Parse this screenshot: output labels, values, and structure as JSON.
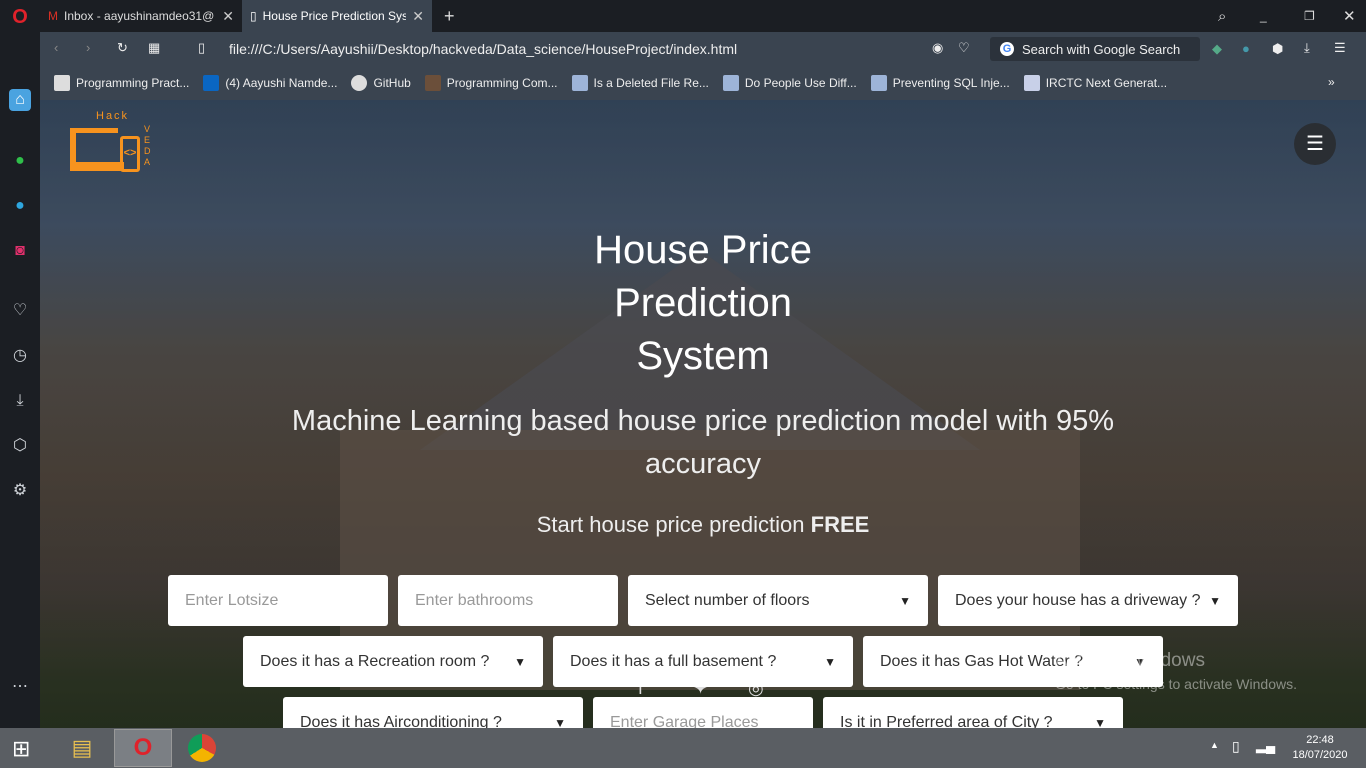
{
  "browser": {
    "tabs": [
      {
        "label": "Inbox - aayushinamdeo31@",
        "icon": "gmail-icon"
      },
      {
        "label": "House Price Prediction Syst",
        "icon": "file-icon",
        "active": true
      }
    ],
    "url": "file:///C:/Users/Aayushii/Desktop/hackveda/Data_science/HouseProject/index.html",
    "search_placeholder": "Search with Google Search",
    "bookmarks": [
      {
        "label": "Programming Pract...",
        "color": "#ffffff"
      },
      {
        "label": "(4) Aayushi Namde...",
        "color": "#0a66c2"
      },
      {
        "label": "GitHub",
        "color": "#ffffff"
      },
      {
        "label": "Programming Com...",
        "color": "#6b4f3a"
      },
      {
        "label": "Is a Deleted File Re...",
        "color": "#9db4d8"
      },
      {
        "label": "Do People Use Diff...",
        "color": "#9db4d8"
      },
      {
        "label": "Preventing SQL Inje...",
        "color": "#9db4d8"
      },
      {
        "label": "IRCTC Next Generat...",
        "color": "#c8d0e8"
      }
    ]
  },
  "page": {
    "logo": {
      "text": "Hack",
      "sub": "VEDA",
      "color": "#f7931e"
    },
    "title_lines": [
      "House Price",
      "Prediction",
      "System"
    ],
    "subtitle": "Machine Learning based house price prediction model with 95% accuracy",
    "cta_prefix": "Start house price prediction ",
    "cta_bold": "FREE",
    "form": {
      "lotsize_placeholder": "Enter Lotsize",
      "bathrooms_placeholder": "Enter bathrooms",
      "floors": "Select number of floors",
      "driveway": "Does your house has a driveway ?",
      "recroom": "Does it has a Recreation room ?",
      "basement": "Does it has a full basement ?",
      "gashw": "Does it has Gas Hot Water ?",
      "aircon": "Does it has Airconditioning ?",
      "garage_placeholder": "Enter Garage Places",
      "prefarea": "Is it in Preferred area of City ?"
    }
  },
  "watermark": {
    "title": "Activate Windows",
    "sub": "Go to PC settings to activate Windows."
  },
  "taskbar": {
    "time": "22:48",
    "date": "18/07/2020"
  }
}
